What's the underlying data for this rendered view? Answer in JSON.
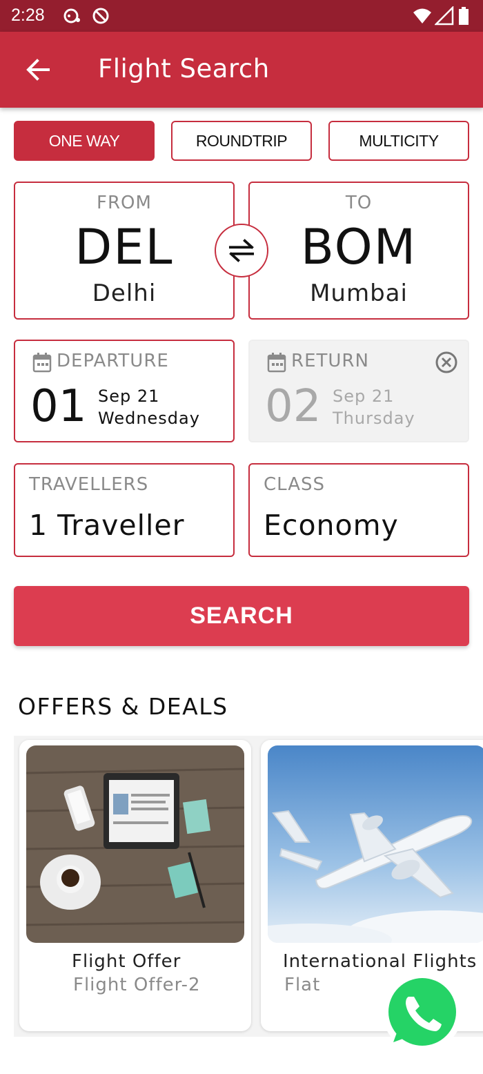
{
  "status_bar": {
    "time": "2:28"
  },
  "header": {
    "title": "Flight Search"
  },
  "trip_types": [
    {
      "label": "ONE WAY",
      "active": true
    },
    {
      "label": "ROUNDTRIP",
      "active": false
    },
    {
      "label": "MULTICITY",
      "active": false
    }
  ],
  "from": {
    "label": "FROM",
    "code": "DEL",
    "city": "Delhi"
  },
  "to": {
    "label": "TO",
    "code": "BOM",
    "city": "Mumbai"
  },
  "departure": {
    "label": "DEPARTURE",
    "day": "01",
    "month": "Sep 21",
    "weekday": "Wednesday"
  },
  "return": {
    "label": "RETURN",
    "day": "02",
    "month": "Sep 21",
    "weekday": "Thursday",
    "enabled": false
  },
  "travellers": {
    "label": "TRAVELLERS",
    "value": "1 Traveller"
  },
  "class": {
    "label": "CLASS",
    "value": "Economy"
  },
  "search": {
    "label": "SEARCH"
  },
  "offers": {
    "title": "OFFERS & DEALS",
    "items": [
      {
        "title": "Flight Offer",
        "subtitle": "Flight Offer-2"
      },
      {
        "title": "International Flights",
        "subtitle": "Flat"
      }
    ]
  },
  "colors": {
    "primary": "#c62d3e",
    "status_bar": "#941e2e",
    "search_button": "#dc3d50",
    "whatsapp": "#25d366"
  },
  "icons": [
    "back-arrow-icon",
    "swap-icon",
    "calendar-icon",
    "clear-icon",
    "whatsapp-icon",
    "wifi-icon",
    "signal-icon",
    "battery-icon"
  ]
}
